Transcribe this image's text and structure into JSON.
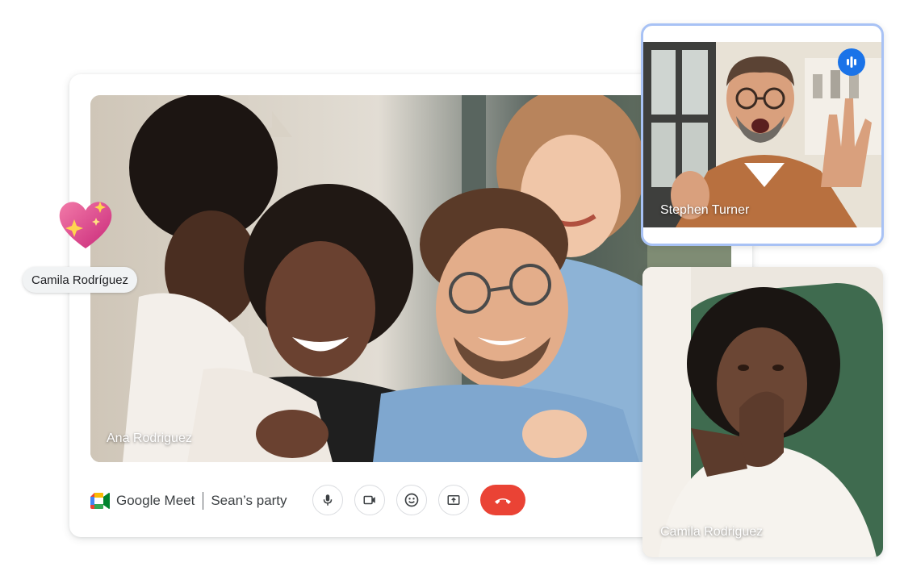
{
  "meeting": {
    "app_name": "Google Meet",
    "meeting_name": "Sean’s party"
  },
  "participants": {
    "main": {
      "name": "Ana Rodriguez"
    },
    "top_tile": {
      "name": "Stephen Turner",
      "speaking": true
    },
    "bottom_tile": {
      "name": "Camila Rodriguez"
    }
  },
  "reaction": {
    "emoji_icon": "sparkling-heart-icon",
    "sender": "Camila Rodríguez"
  },
  "controls": {
    "icons": [
      "microphone-icon",
      "camera-icon",
      "emoji-reaction-icon",
      "present-screen-icon",
      "end-call-icon"
    ]
  },
  "colors": {
    "end_call": "#ea4335",
    "speaking_badge": "#1a73e8",
    "active_tile_border": "#a8c2f5",
    "text": "#3c4043"
  }
}
